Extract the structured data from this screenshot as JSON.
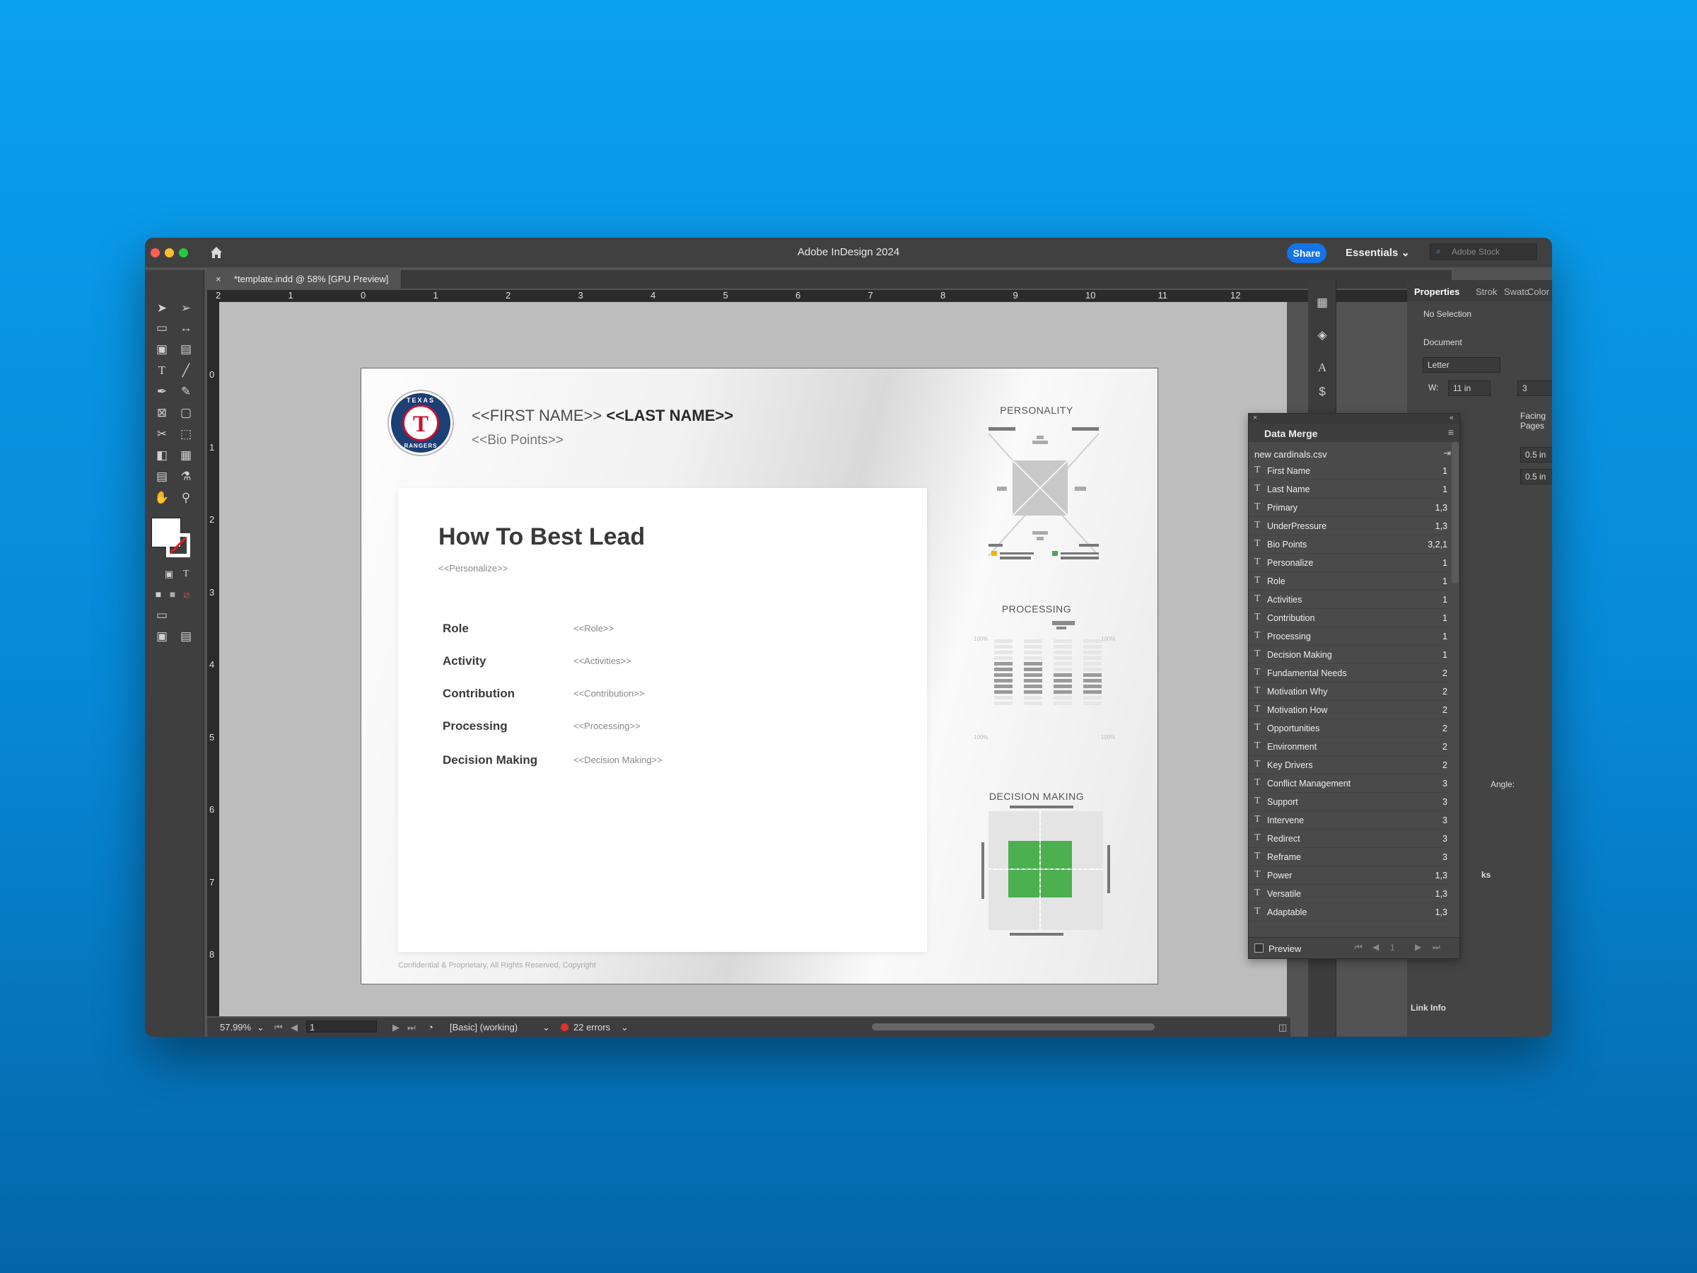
{
  "window": {
    "title": "Adobe InDesign 2024"
  },
  "titlebar": {
    "share": "Share",
    "workspace": "Essentials",
    "search_placeholder": "Adobe Stock"
  },
  "doc_tab": {
    "label": "*template.indd @ 58% [GPU Preview]"
  },
  "rulers": {
    "h": [
      "2",
      "1",
      "0",
      "1",
      "2",
      "3",
      "4",
      "5",
      "6",
      "7",
      "8",
      "9",
      "10",
      "11",
      "12"
    ],
    "v": [
      "0",
      "1",
      "2",
      "3",
      "4",
      "5",
      "6",
      "7",
      "8"
    ]
  },
  "page": {
    "first_name": "<<FIRST NAME>>",
    "last_name": "<<LAST NAME>>",
    "bio": "<<Bio Points>>",
    "heading": "How To Best Lead",
    "personalize": "<<Personalize>>",
    "rows": [
      {
        "label": "Role",
        "value": "<<Role>>"
      },
      {
        "label": "Activity",
        "value": "<<Activities>>"
      },
      {
        "label": "Contribution",
        "value": "<<Contribution>>"
      },
      {
        "label": "Processing",
        "value": "<<Processing>>"
      },
      {
        "label": "Decision Making",
        "value": "<<Decision Making>>"
      }
    ],
    "footer": "Confidential & Proprietary, All Rights Reserved, Copyright",
    "charts": {
      "personality": "PERSONALITY",
      "processing": "PROCESSING",
      "decision": "DECISION MAKING"
    },
    "processing_axis": {
      "top": "100%",
      "bottom": "100%"
    }
  },
  "data_merge": {
    "title": "Data Merge",
    "file": "new cardinals.csv",
    "fields": [
      {
        "name": "First Name",
        "pages": "1"
      },
      {
        "name": "Last Name",
        "pages": "1"
      },
      {
        "name": "Primary",
        "pages": "1,3"
      },
      {
        "name": "UnderPressure",
        "pages": "1,3"
      },
      {
        "name": "Bio Points",
        "pages": "3,2,1"
      },
      {
        "name": "Personalize",
        "pages": "1"
      },
      {
        "name": "Role",
        "pages": "1"
      },
      {
        "name": "Activities",
        "pages": "1"
      },
      {
        "name": "Contribution",
        "pages": "1"
      },
      {
        "name": "Processing",
        "pages": "1"
      },
      {
        "name": "Decision Making",
        "pages": "1"
      },
      {
        "name": "Fundamental Needs",
        "pages": "2"
      },
      {
        "name": "Motivation Why",
        "pages": "2"
      },
      {
        "name": "Motivation How",
        "pages": "2"
      },
      {
        "name": "Opportunities",
        "pages": "2"
      },
      {
        "name": "Environment",
        "pages": "2"
      },
      {
        "name": "Key Drivers",
        "pages": "2"
      },
      {
        "name": "Conflict Management",
        "pages": "3"
      },
      {
        "name": "Support",
        "pages": "3"
      },
      {
        "name": "Intervene",
        "pages": "3"
      },
      {
        "name": "Redirect",
        "pages": "3"
      },
      {
        "name": "Reframe",
        "pages": "3"
      },
      {
        "name": "Power",
        "pages": "1,3"
      },
      {
        "name": "Versatile",
        "pages": "1,3"
      },
      {
        "name": "Adaptable",
        "pages": "1,3"
      }
    ],
    "preview_label": "Preview",
    "record": "1"
  },
  "properties": {
    "tabs": [
      "Properties",
      "Strok",
      "Swatc",
      "Color"
    ],
    "no_selection": "No Selection",
    "document": "Document",
    "page_size": "Letter",
    "width_label": "W:",
    "width": "11 in",
    "pages": "3",
    "facing_pages": "Facing Pages",
    "margin_top": "0.5 in",
    "margin_bottom": "0.5 in",
    "angle": "Angle:",
    "links_tab": "ks",
    "link_info": "Link Info"
  },
  "status": {
    "zoom": "57.99%",
    "page": "1",
    "preflight_profile": "[Basic] (working)",
    "errors": "22 errors"
  }
}
